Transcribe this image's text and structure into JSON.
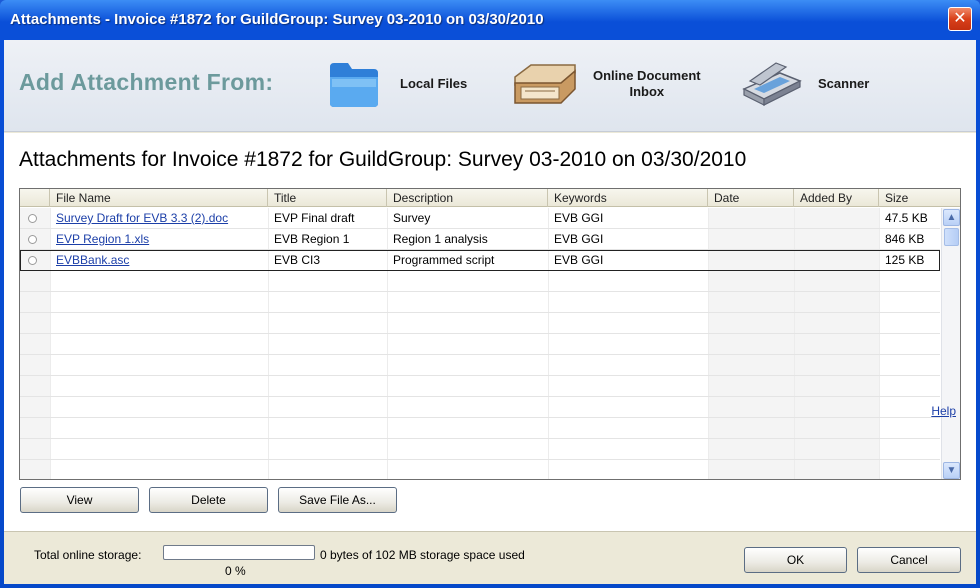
{
  "window": {
    "title": "Attachments - Invoice #1872 for GuildGroup: Survey 03-2010 on 03/30/2010",
    "close_label": "✕"
  },
  "add_from": {
    "heading": "Add Attachment From:",
    "options": [
      {
        "label": "Local Files",
        "icon": "folder-icon"
      },
      {
        "label_line1": "Online Document",
        "label_line2": "Inbox",
        "icon": "inbox-tray-icon"
      },
      {
        "label": "Scanner",
        "icon": "scanner-icon"
      }
    ]
  },
  "attachments": {
    "section_title": "Attachments for Invoice #1872 for GuildGroup: Survey 03-2010 on 03/30/2010",
    "columns": [
      "File Name",
      "Title",
      "Description",
      "Keywords",
      "Date",
      "Added By",
      "Size"
    ],
    "rows": [
      {
        "file_name": "Survey Draft for EVB 3.3 (2).doc",
        "title": "EVP Final draft",
        "description": "Survey",
        "keywords": "EVB GGI",
        "date": "",
        "added_by": "",
        "size": "47.5 KB"
      },
      {
        "file_name": "EVP Region 1.xls",
        "title": "EVB Region 1",
        "description": "Region 1 analysis",
        "keywords": "EVB GGI",
        "date": "",
        "added_by": "",
        "size": "846 KB"
      },
      {
        "file_name": "EVBBank.asc",
        "title": "EVB CI3",
        "description": "Programmed script",
        "keywords": "EVB GGI",
        "date": "",
        "added_by": "",
        "size": "125 KB"
      }
    ],
    "selected_row": 2
  },
  "actions": {
    "view": "View",
    "delete": "Delete",
    "save_as": "Save File As...",
    "help": "Help"
  },
  "storage": {
    "label": "Total online storage:",
    "used_text": "0 bytes of 102 MB storage space used",
    "percent_text": "0 %",
    "percent_value": 0
  },
  "footer": {
    "ok": "OK",
    "cancel": "Cancel"
  }
}
